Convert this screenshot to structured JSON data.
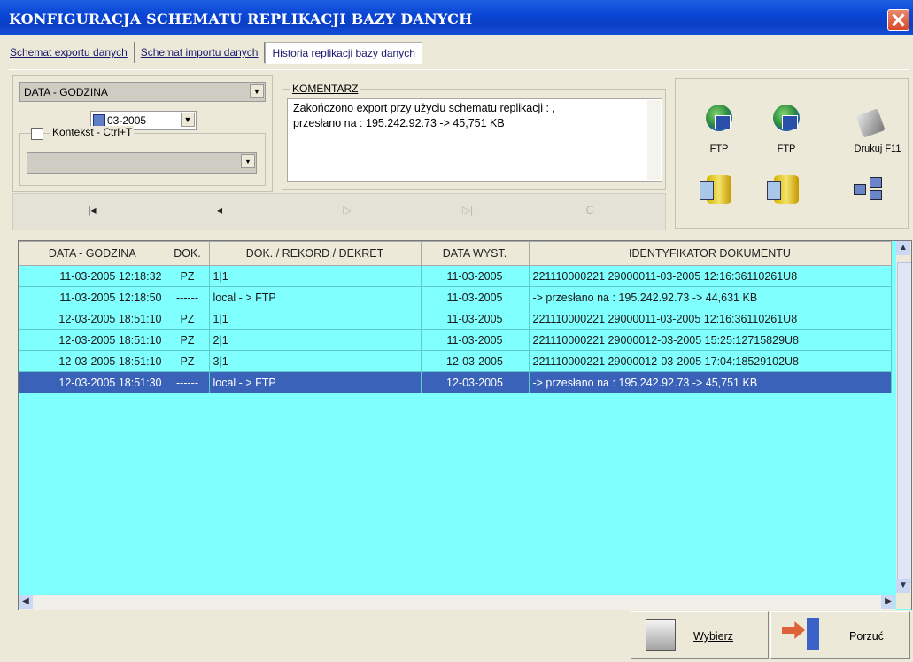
{
  "window": {
    "title": "KONFIGURACJA SCHEMATU REPLIKACJI BAZY DANYCH"
  },
  "tabs": [
    {
      "label": "Schemat exportu danych"
    },
    {
      "label": "Schemat importu danych"
    },
    {
      "label": "Historia replikacji bazy danych"
    }
  ],
  "filter": {
    "field_select": "DATA - GODZINA",
    "date_value": "03-2005",
    "context_label": "Kontekst - Ctrl+T"
  },
  "comment": {
    "label": "KOMENTARZ",
    "line1": "Zakończono export przy użyciu schematu replikacji : ,",
    "line2": "przesłano na : 195.242.92.73 -> 45,751 KB"
  },
  "nav": {
    "first": "|◂",
    "prev": "◂",
    "next": "▷",
    "last": "▷|",
    "refresh": "C"
  },
  "tools": [
    {
      "label": "FTP",
      "icon": "ftp-globe-icon"
    },
    {
      "label": "FTP",
      "icon": "ftp-globe-icon"
    },
    {
      "label": "Drukuj F11",
      "icon": "printer-icon"
    }
  ],
  "grid": {
    "headers": [
      "DATA - GODZINA",
      "DOK.",
      "DOK. / REKORD / DEKRET",
      "DATA WYST.",
      "IDENTYFIKATOR DOKUMENTU"
    ],
    "rows": [
      [
        "11-03-2005 12:18:32",
        "PZ",
        "1|1",
        "11-03-2005",
        "221110000221 29000011-03-2005 12:16:36110261U8"
      ],
      [
        "11-03-2005 12:18:50",
        "------",
        "local - > FTP",
        "11-03-2005",
        "-> przesłano na : 195.242.92.73 -> 44,631 KB"
      ],
      [
        "12-03-2005 18:51:10",
        "PZ",
        "1|1",
        "11-03-2005",
        "221110000221 29000011-03-2005 12:16:36110261U8"
      ],
      [
        "12-03-2005 18:51:10",
        "PZ",
        "2|1",
        "11-03-2005",
        "221110000221 29000012-03-2005 15:25:12715829U8"
      ],
      [
        "12-03-2005 18:51:10",
        "PZ",
        "3|1",
        "12-03-2005",
        "221110000221 29000012-03-2005 17:04:18529102U8"
      ],
      [
        "12-03-2005 18:51:30",
        "------",
        "local - > FTP",
        "12-03-2005",
        "-> przesłano na : 195.242.92.73 -> 45,751 KB"
      ]
    ],
    "selected_index": 5
  },
  "buttons": {
    "select": "Wybierz",
    "cancel": "Porzuć"
  }
}
